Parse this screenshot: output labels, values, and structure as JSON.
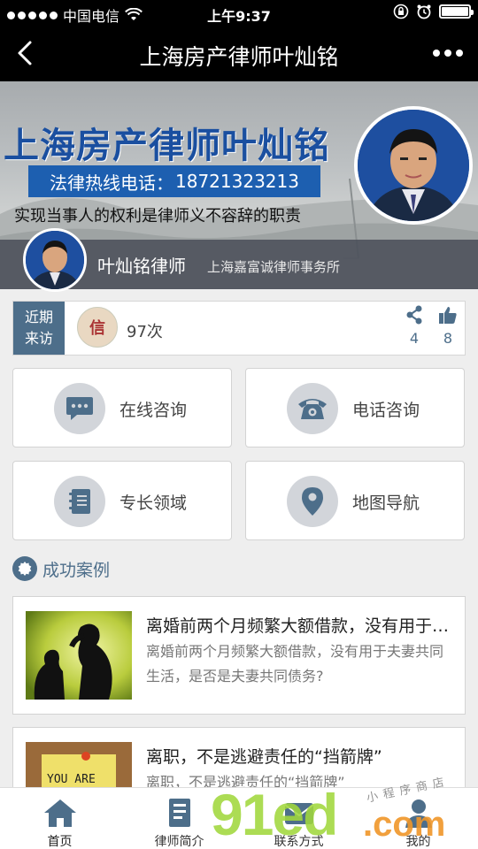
{
  "status_bar": {
    "carrier": "中国电信",
    "time": "上午9:37"
  },
  "nav": {
    "title": "上海房产律师叶灿铭"
  },
  "banner": {
    "title": "上海房产律师叶灿铭",
    "hotline_label": "法律热线电话：",
    "hotline_number": "18721323213",
    "motto": "实现当事人的权利是律师义不容辞的职责",
    "lawyer_name": "叶灿铭律师",
    "law_firm": "上海嘉富诚律师事务所"
  },
  "visits": {
    "label_line1": "近期",
    "label_line2": "来访",
    "visitor_avatar_text": "信",
    "count": "97次",
    "share_count": "4",
    "like_count": "8"
  },
  "functions": [
    {
      "label": "在线咨询",
      "icon": "chat-bubble-icon"
    },
    {
      "label": "电话咨询",
      "icon": "telephone-icon"
    },
    {
      "label": "专长领域",
      "icon": "notebook-icon"
    },
    {
      "label": "地图导航",
      "icon": "map-pin-icon"
    }
  ],
  "cases_section": {
    "title": "成功案例"
  },
  "cases": [
    {
      "title": "离婚前两个月频繁大额借款，没有用于夫妻共同生活，是否是夫妻共同债务？",
      "desc": "离婚前两个月频繁大额借款，没有用于夫妻共同生活，是否是夫妻共同债务?",
      "thumb_text": ""
    },
    {
      "title": "离职，不是逃避责任的“挡箭牌”",
      "desc": "离职，不是逃避责任的“挡箭牌”",
      "thumb_text": "YOU ARE"
    }
  ],
  "tabs": [
    {
      "label": "首页",
      "icon": "home-icon"
    },
    {
      "label": "律师简介",
      "icon": "document-icon"
    },
    {
      "label": "联系方式",
      "icon": "contact-icon"
    },
    {
      "label": "我的",
      "icon": "user-icon"
    }
  ],
  "watermark": {
    "main": "91ed",
    "suffix": ".com",
    "small": "小程序商店"
  },
  "colors": {
    "accent": "#4d6e8a",
    "banner_title": "#1a4fa0",
    "hotline_bg": "#1d5fb0",
    "icon_circle": "#d2d5da"
  }
}
